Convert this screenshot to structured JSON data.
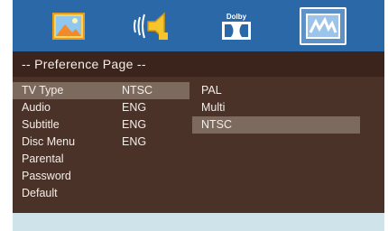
{
  "icons": [
    {
      "name": "picture-icon"
    },
    {
      "name": "audio-speaker-icon"
    },
    {
      "name": "dolby-icon",
      "label": "Dolby"
    },
    {
      "name": "preference-icon"
    }
  ],
  "page_title": "-- Preference  Page --",
  "menu_items": [
    {
      "label": "TV Type",
      "value": "NTSC"
    },
    {
      "label": "Audio",
      "value": "ENG"
    },
    {
      "label": "Subtitle",
      "value": "ENG"
    },
    {
      "label": "Disc Menu",
      "value": "ENG"
    },
    {
      "label": "Parental",
      "value": ""
    },
    {
      "label": "Password",
      "value": ""
    },
    {
      "label": "Default",
      "value": ""
    }
  ],
  "submenu": [
    "PAL",
    "Multi",
    "NTSC"
  ],
  "colors": {
    "icon_bar": "#2b68a8",
    "title_bar": "#3a241b",
    "menu_bg": "#4a3228",
    "highlight": "#7c6a5e",
    "bottom_bar": "#cfe3ea"
  }
}
